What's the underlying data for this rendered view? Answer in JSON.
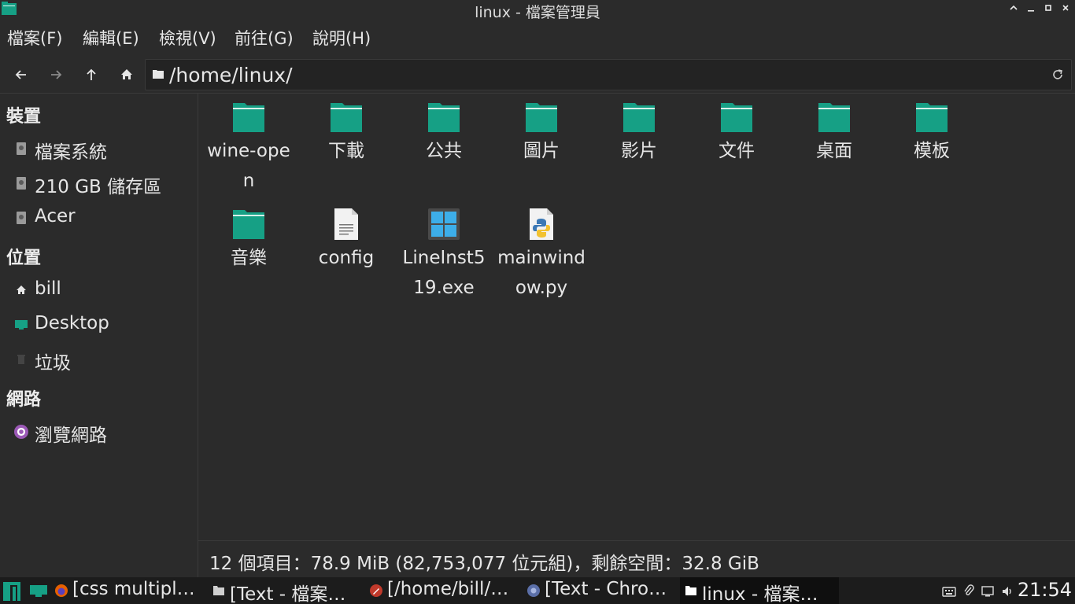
{
  "window": {
    "title": "linux - 檔案管理員",
    "controls": {
      "maximize_up": "^",
      "minimize": "–",
      "restore": "□",
      "close": "✕"
    }
  },
  "menubar": {
    "items": [
      {
        "label": "檔案(F)"
      },
      {
        "label": "編輯(E)"
      },
      {
        "label": "檢視(V)"
      },
      {
        "label": "前往(G)"
      },
      {
        "label": "說明(H)"
      }
    ]
  },
  "toolbar": {
    "path": "/home/linux/",
    "icons": [
      "back-icon",
      "forward-icon",
      "up-icon",
      "home-icon",
      "refresh-icon"
    ]
  },
  "sidebar": {
    "sections": [
      {
        "header": "裝置",
        "items": [
          {
            "label": "檔案系統",
            "icon": "drive-icon"
          },
          {
            "label": "210 GB 儲存區",
            "icon": "drive-icon"
          },
          {
            "label": "Acer",
            "icon": "drive-icon"
          }
        ]
      },
      {
        "header": "位置",
        "items": [
          {
            "label": "bill",
            "icon": "home-icon"
          },
          {
            "label": "Desktop",
            "icon": "desktop-icon"
          },
          {
            "label": "垃圾",
            "icon": "trash-icon"
          }
        ]
      },
      {
        "header": "網路",
        "items": [
          {
            "label": "瀏覽網路",
            "icon": "network-icon"
          }
        ]
      }
    ]
  },
  "files": [
    {
      "name": "wine-open",
      "type": "folder"
    },
    {
      "name": "下載",
      "type": "folder"
    },
    {
      "name": "公共",
      "type": "folder"
    },
    {
      "name": "圖片",
      "type": "folder"
    },
    {
      "name": "影片",
      "type": "folder"
    },
    {
      "name": "文件",
      "type": "folder"
    },
    {
      "name": "桌面",
      "type": "folder"
    },
    {
      "name": "模板",
      "type": "folder"
    },
    {
      "name": "音樂",
      "type": "folder"
    },
    {
      "name": "config",
      "type": "text-file"
    },
    {
      "name": "LineInst519.exe",
      "type": "exe-file"
    },
    {
      "name": "mainwindow.py",
      "type": "python-file"
    }
  ],
  "status": {
    "text": "12 個項目：78.9 MiB (82,753,077 位元組)，剩餘空間：32.8 GiB"
  },
  "taskbar": {
    "tasks": [
      {
        "label": "[css multipl…",
        "icon": "firefox-icon",
        "active": false
      },
      {
        "label": "[Text - 檔案…",
        "icon": "folder-icon",
        "active": false
      },
      {
        "label": "[/home/bill/…",
        "icon": "editor-icon",
        "active": false
      },
      {
        "label": "[Text - Chro…",
        "icon": "chrome-icon",
        "active": false
      },
      {
        "label": "linux - 檔案…",
        "icon": "folder-icon",
        "active": true
      }
    ],
    "clock": "21:54"
  },
  "colors": {
    "accent": "#16a085",
    "background": "#2b2b2b",
    "taskbar": "#1c1c1c"
  }
}
